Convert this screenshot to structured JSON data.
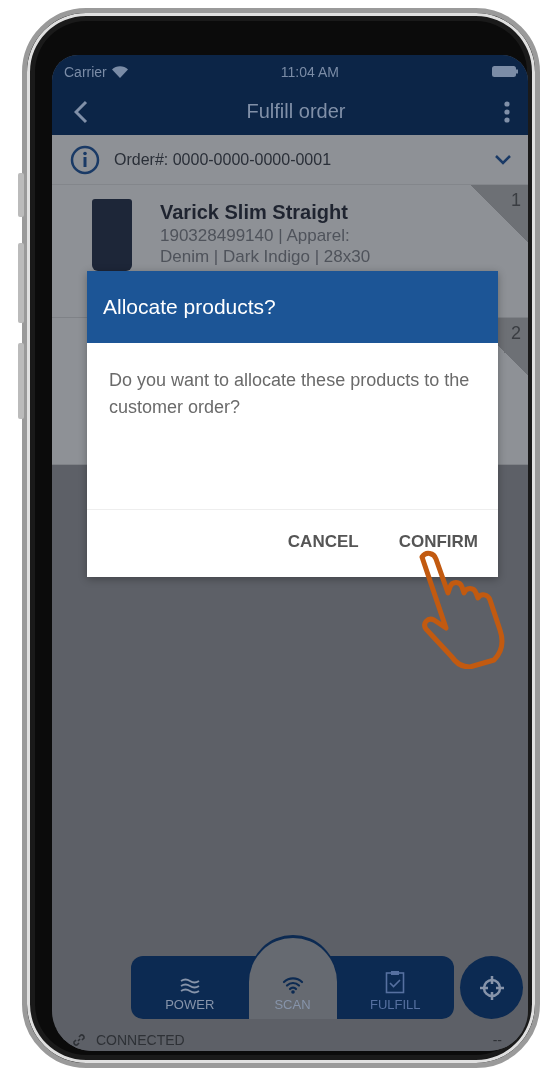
{
  "status_bar": {
    "carrier": "Carrier",
    "time": "11:04 AM"
  },
  "header": {
    "title": "Fulfill order"
  },
  "order": {
    "label": "Order#: 0000-0000-0000-0001",
    "expanded": false
  },
  "items": [
    {
      "index": "1",
      "name": "Varick Slim Straight",
      "details": "190328499140 | Apparel: Denim | Dark Indigo | 28x30"
    },
    {
      "index": "2"
    }
  ],
  "dialog": {
    "title": "Allocate products?",
    "message": "Do you want to allocate these products to the customer order?",
    "buttons": [
      "CANCEL",
      "CONFIRM"
    ]
  },
  "bottom_nav": [
    {
      "label": "POWER",
      "selected": false,
      "disabled": false,
      "kind": "waves"
    },
    {
      "label": "SCAN",
      "selected": true,
      "disabled": false,
      "kind": "wifi"
    },
    {
      "label": "FULFILL",
      "selected": false,
      "disabled": true,
      "kind": "clipboard"
    }
  ],
  "connection": {
    "status": "CONNECTED",
    "reading": "--"
  }
}
